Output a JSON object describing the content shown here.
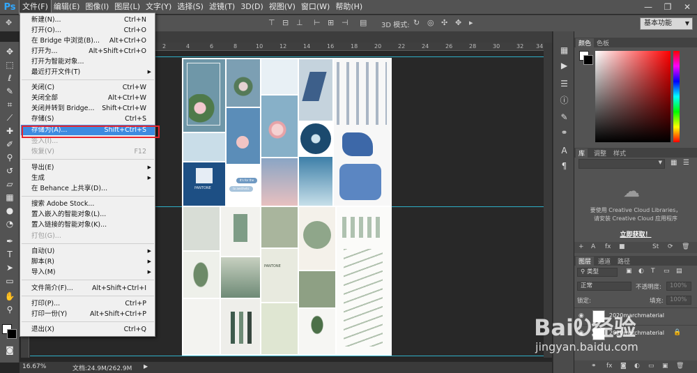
{
  "menubar": {
    "logo": "Ps",
    "items": [
      "文件(F)",
      "编辑(E)",
      "图像(I)",
      "图层(L)",
      "文字(Y)",
      "选择(S)",
      "滤镜(T)",
      "3D(D)",
      "视图(V)",
      "窗口(W)",
      "帮助(H)"
    ],
    "window_controls": [
      "—",
      "❐",
      "✕"
    ]
  },
  "optionsbar": {
    "label_3d_mode": "3D 模式:",
    "workspace": "基本功能"
  },
  "file_menu": {
    "items": [
      {
        "label": "新建(N)...",
        "shortcut": "Ctrl+N",
        "enabled": true
      },
      {
        "label": "打开(O)...",
        "shortcut": "Ctrl+O",
        "enabled": true
      },
      {
        "label": "在 Bridge 中浏览(B)...",
        "shortcut": "Alt+Ctrl+O",
        "enabled": true
      },
      {
        "label": "打开为...",
        "shortcut": "Alt+Shift+Ctrl+O",
        "enabled": true
      },
      {
        "label": "打开为智能对象...",
        "shortcut": "",
        "enabled": true
      },
      {
        "label": "最近打开文件(T)",
        "shortcut": "",
        "enabled": true,
        "submenu": true
      },
      {
        "label": "关闭(C)",
        "shortcut": "Ctrl+W",
        "enabled": true
      },
      {
        "label": "关闭全部",
        "shortcut": "Alt+Ctrl+W",
        "enabled": true
      },
      {
        "label": "关闭并转到 Bridge...",
        "shortcut": "Shift+Ctrl+W",
        "enabled": true
      },
      {
        "label": "存储(S)",
        "shortcut": "Ctrl+S",
        "enabled": true
      },
      {
        "label": "存储为(A)...",
        "shortcut": "Shift+Ctrl+S",
        "enabled": true,
        "highlighted": true
      },
      {
        "label": "签入(I)...",
        "shortcut": "",
        "enabled": false
      },
      {
        "label": "恢复(V)",
        "shortcut": "F12",
        "enabled": false
      },
      {
        "label": "导出(E)",
        "shortcut": "",
        "enabled": true,
        "submenu": true
      },
      {
        "label": "生成",
        "shortcut": "",
        "enabled": true,
        "submenu": true
      },
      {
        "label": "在 Behance 上共享(D)...",
        "shortcut": "",
        "enabled": true
      },
      {
        "label": "搜索 Adobe Stock...",
        "shortcut": "",
        "enabled": true
      },
      {
        "label": "置入嵌入的智能对象(L)...",
        "shortcut": "",
        "enabled": true
      },
      {
        "label": "置入链接的智能对象(K)...",
        "shortcut": "",
        "enabled": true
      },
      {
        "label": "打包(G)...",
        "shortcut": "",
        "enabled": false
      },
      {
        "label": "自动(U)",
        "shortcut": "",
        "enabled": true,
        "submenu": true
      },
      {
        "label": "脚本(R)",
        "shortcut": "",
        "enabled": true,
        "submenu": true
      },
      {
        "label": "导入(M)",
        "shortcut": "",
        "enabled": true,
        "submenu": true
      },
      {
        "label": "文件简介(F)...",
        "shortcut": "Alt+Shift+Ctrl+I",
        "enabled": true
      },
      {
        "label": "打印(P)...",
        "shortcut": "Ctrl+P",
        "enabled": true
      },
      {
        "label": "打印一份(Y)",
        "shortcut": "Alt+Shift+Ctrl+P",
        "enabled": true
      },
      {
        "label": "退出(X)",
        "shortcut": "Ctrl+Q",
        "enabled": true
      }
    ]
  },
  "ruler": {
    "ticks": [
      "2",
      "4",
      "6",
      "8",
      "10",
      "12",
      "14",
      "16",
      "18",
      "20",
      "22",
      "24",
      "26",
      "28",
      "30",
      "32",
      "34"
    ]
  },
  "canvas": {
    "guide_color": "#2fb0c8",
    "artboard_texts": {
      "pantone_blue": "PANTONE",
      "pantone_green": "PANTONE",
      "bubble1": "It's for the",
      "bubble2": "to aesthetic"
    }
  },
  "statusbar": {
    "zoom": "16.67%",
    "doc_size": "文档:24.9M/262.9M"
  },
  "color_panel": {
    "tabs": [
      "颜色",
      "色板"
    ],
    "foreground": "#ffffff",
    "background": "#000000"
  },
  "library_panel": {
    "tabs": [
      "库",
      "调整",
      "样式"
    ],
    "message_line1": "要使用 Creative Cloud Libraries，",
    "message_line2": "请安装 Creative Cloud 应用程序",
    "link": "立即获取！"
  },
  "layers_panel": {
    "tabs": [
      "图层",
      "通道",
      "路径"
    ],
    "filter_kind": "类型",
    "blend_mode": "正常",
    "opacity_label": "不透明度:",
    "opacity_value": "100%",
    "lock_label": "锁定:",
    "fill_label": "填充:",
    "fill_value": "100%",
    "layers": [
      {
        "name": "2020marchmaterial"
      },
      {
        "name": "2020marchmaterial"
      }
    ]
  },
  "watermark": {
    "logo": "BaiᎧ经验",
    "url": "jingyan.baidu.com"
  }
}
